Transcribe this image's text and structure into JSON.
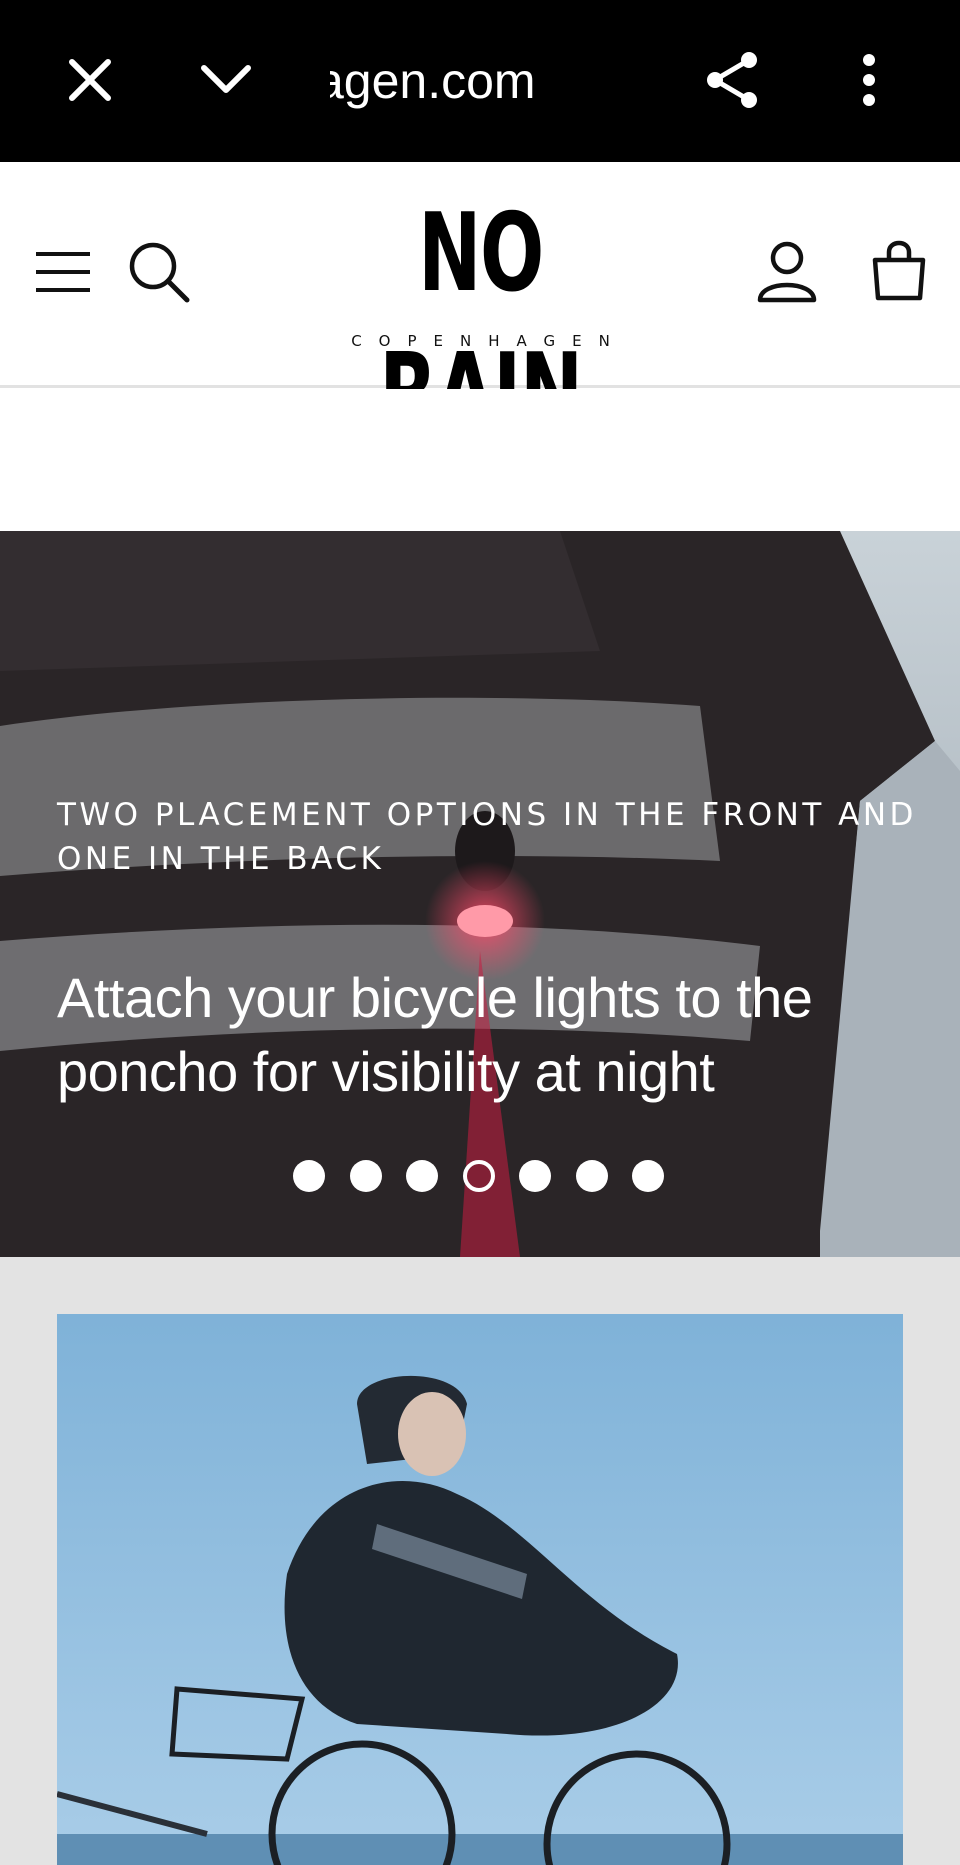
{
  "browser": {
    "url": "agen.com",
    "icons": [
      "close-icon",
      "chevron-down-icon",
      "share-icon",
      "more-vert-icon"
    ]
  },
  "header": {
    "logo_text": "NO RAIN",
    "logo_subtext": "COPENHAGEN",
    "icons": [
      "menu-icon",
      "search-icon",
      "account-icon",
      "cart-icon"
    ]
  },
  "hero": {
    "eyebrow": "TWO PLACEMENT OPTIONS IN THE FRONT AND ONE IN THE BACK",
    "headline": "Attach your bicycle lights to the poncho for visibility at night",
    "slide_count": 7,
    "active_slide": 4
  },
  "colors": {
    "browser_bar": "#000000",
    "header_bg": "#ffffff",
    "section_bg": "#e3e3e3",
    "hero_text": "#ffffff"
  }
}
